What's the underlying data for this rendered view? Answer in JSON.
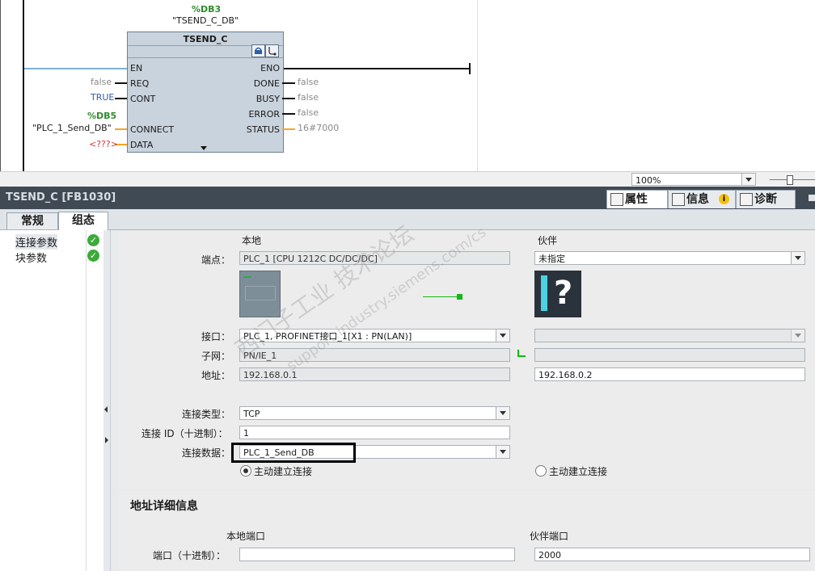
{
  "ladder": {
    "instance_db": "%DB3",
    "instance_db_symbol": "\"TSEND_C_DB\"",
    "block_name": "TSEND_C",
    "pins_left": [
      "EN",
      "REQ",
      "CONT",
      "CONNECT",
      "DATA"
    ],
    "pins_right": [
      "ENO",
      "DONE",
      "BUSY",
      "ERROR",
      "STATUS"
    ],
    "req_value": "false",
    "cont_value": "TRUE",
    "connect_db": "%DB5",
    "connect_symbol": "\"PLC_1_Send_DB\"",
    "data_value": "<???>",
    "done_value": "false",
    "busy_value": "false",
    "error_value": "false",
    "status_value": "16#7000"
  },
  "zoom": {
    "value": "100%"
  },
  "inspector": {
    "title": "TSEND_C [FB1030]",
    "tabs": [
      "属性",
      "信息",
      "诊断"
    ],
    "subtabs": [
      "常规",
      "组态"
    ],
    "left_items": [
      "连接参数",
      "块参数"
    ]
  },
  "connection": {
    "local_header": "本地",
    "partner_header": "伙伴",
    "endpoint_label": "端点：",
    "local_endpoint": "PLC_1 [CPU 1212C DC/DC/DC]",
    "partner_endpoint": "未指定",
    "interface_label": "接口：",
    "local_interface": "PLC_1, PROFINET接口_1[X1 : PN(LAN)]",
    "partner_interface": "",
    "subnet_label": "子网：",
    "local_subnet": "PN/IE_1",
    "partner_subnet": "",
    "address_label": "地址：",
    "local_address": "192.168.0.1",
    "partner_address": "192.168.0.2",
    "type_label": "连接类型：",
    "type_value": "TCP",
    "id_label": "连接 ID（十进制）：",
    "id_value": "1",
    "data_label": "连接数据：",
    "data_value": "PLC_1_Send_DB",
    "local_active_label": "主动建立连接",
    "partner_active_label": "主动建立连接"
  },
  "address_details": {
    "title": "地址详细信息",
    "local_port_header": "本地端口",
    "partner_port_header": "伙伴端口",
    "port_label": "端口（十进制）：",
    "local_port": "",
    "partner_port": "2000"
  },
  "watermark": {
    "text1": "西门子工业 技术论坛",
    "text2": "support.industry.siemens.com/cs"
  },
  "colors": {
    "accent_green": "#3daa3a",
    "header_dark": "#3f4a55",
    "highlight_box": "#000000"
  }
}
